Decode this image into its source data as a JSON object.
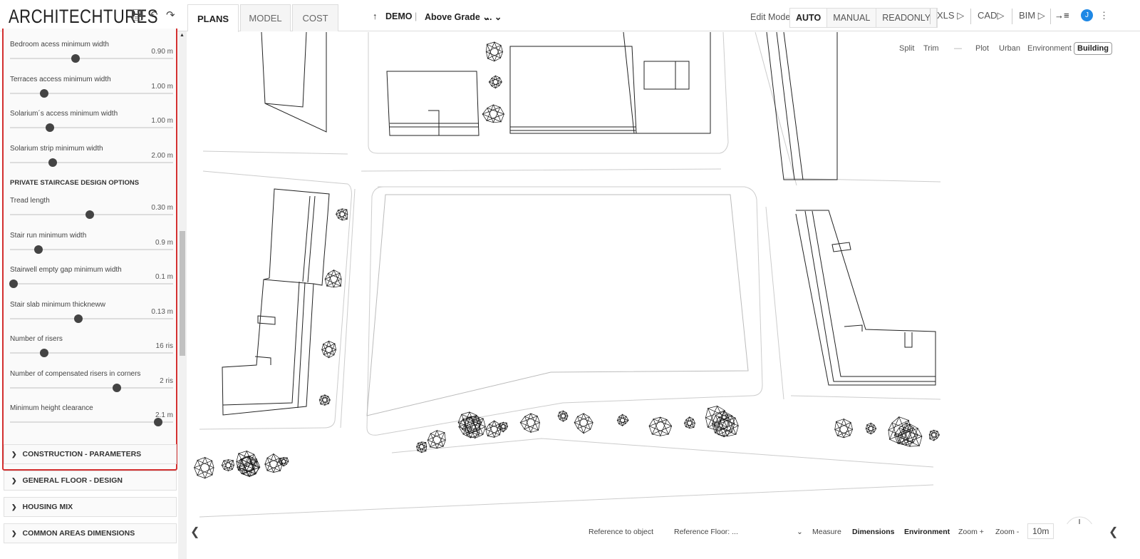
{
  "app": {
    "logo": "ARCHITECHTURES",
    "icons": [
      "save-icon",
      "undo-icon",
      "redo-icon"
    ]
  },
  "tabs": [
    {
      "label": "PLANS",
      "active": true
    },
    {
      "label": "MODEL"
    },
    {
      "label": "COST"
    }
  ],
  "project": {
    "name": "DEMO",
    "level": "Above Grade",
    "more": "..."
  },
  "edit_mode": {
    "label": "Edit Mode:",
    "options": [
      "AUTO",
      "MANUAL",
      "READONLY"
    ],
    "selected": "AUTO"
  },
  "exports": [
    "XLS",
    "CAD",
    "BIM"
  ],
  "user": {
    "initial": "J",
    "color": "#1e88e5"
  },
  "view_toggles": {
    "left": [
      "Split",
      "Trim",
      "—"
    ],
    "right": [
      "Plot",
      "Urban",
      "Environment",
      "Building"
    ],
    "selected": "Building"
  },
  "sidebar": {
    "sliders_a": [
      {
        "label": "Bedroom acess minimum width",
        "value": "0.90 m",
        "level": 0.4
      },
      {
        "label": "Terraces access minimum width",
        "value": "1.00 m",
        "level": 0.21
      },
      {
        "label": "Solarium´s access minimum width",
        "value": "1.00 m",
        "level": 0.245
      },
      {
        "label": "Solarium strip minimum width",
        "value": "2.00 m",
        "level": 0.26
      }
    ],
    "section_title": "PRIVATE STAIRCASE DESIGN OPTIONS",
    "sliders_b": [
      {
        "label": "Tread length",
        "value": "0.30 m",
        "level": 0.49
      },
      {
        "label": "Stair run minimum width",
        "value": "0.9 m",
        "level": 0.175
      },
      {
        "label": "Stairwell empty gap minimum width",
        "value": "0.1 m",
        "level": 0.02
      },
      {
        "label": "Stair slab minimum thickneww",
        "value": "0.13 m",
        "level": 0.42
      },
      {
        "label": "Number of risers",
        "value": "16 ris",
        "level": 0.21
      },
      {
        "label": "Number of compensated risers in corners",
        "value": "2 ris",
        "level": 0.655
      },
      {
        "label": "Minimum height clearance",
        "value": "2.1 m",
        "level": 0.91
      }
    ],
    "accordions": [
      "CONSTRUCTION - PARAMETERS",
      "GENERAL FLOOR - DESIGN",
      "HOUSING MIX",
      "COMMON AREAS DIMENSIONS"
    ],
    "accent": "#d32f2f"
  },
  "bottom": {
    "reference_object": "Reference to object",
    "reference_floor": "Reference Floor:  ...",
    "measure": "Measure",
    "dimensions": "Dimensions",
    "environment": "Environment",
    "zoom_in": "Zoom +",
    "zoom_out": "Zoom -",
    "scale": "10m"
  }
}
